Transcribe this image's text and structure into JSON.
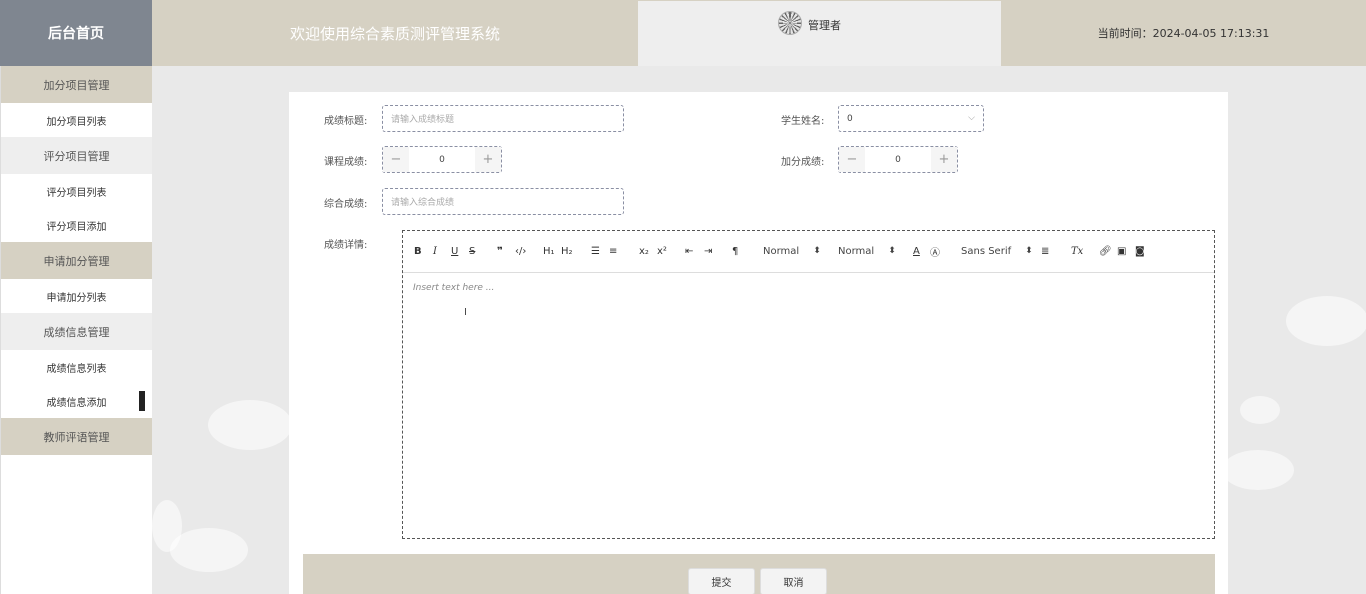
{
  "header": {
    "brand": "后台首页",
    "system_title": "欢迎使用综合素质测评管理系统",
    "username": "管理者",
    "time_label": "当前时间：",
    "time_value": "2024-04-05 17:13:31"
  },
  "sidebar": {
    "groups": [
      {
        "label": "加分项目管理",
        "items": [
          "加分项目列表"
        ]
      },
      {
        "label": "评分项目管理",
        "items": [
          "评分项目列表",
          "评分项目添加"
        ]
      },
      {
        "label": "申请加分管理",
        "items": [
          "申请加分列表"
        ]
      },
      {
        "label": "成绩信息管理",
        "items": [
          "成绩信息列表",
          "成绩信息添加"
        ]
      },
      {
        "label": "教师评语管理",
        "items": []
      }
    ],
    "active_item": "成绩信息添加"
  },
  "form": {
    "title_label": "成绩标题:",
    "title_placeholder": "请输入成绩标题",
    "student_label": "学生姓名:",
    "student_value": "0",
    "course_label": "课程成绩:",
    "course_value": "0",
    "bonus_label": "加分成绩:",
    "bonus_value": "0",
    "total_label": "综合成绩:",
    "total_placeholder": "请输入综合成绩",
    "detail_label": "成绩详情:"
  },
  "editor": {
    "placeholder": "Insert text here ...",
    "header_select": "Normal",
    "size_select": "Normal",
    "font_select": "Sans Serif",
    "toolbar_icons": [
      "bold-icon",
      "italic-icon",
      "underline-icon",
      "strike-icon",
      "blockquote-icon",
      "code-block-icon",
      "h1-icon",
      "h2-icon",
      "ordered-list-icon",
      "bullet-list-icon",
      "subscript-icon",
      "superscript-icon",
      "outdent-icon",
      "indent-icon",
      "direction-icon",
      "color-icon",
      "background-icon",
      "align-icon",
      "clean-icon",
      "link-icon",
      "image-icon",
      "video-icon"
    ]
  },
  "actions": {
    "submit": "提交",
    "cancel": "取消"
  },
  "colors": {
    "header_bg": "#d6d1c3",
    "brand_bg": "#7f8690",
    "page_bg": "#e9e9e9"
  }
}
